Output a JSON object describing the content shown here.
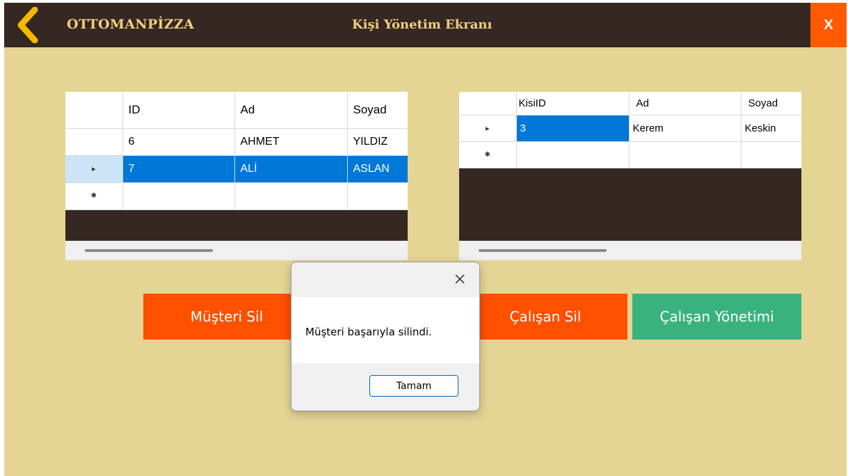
{
  "header": {
    "brand": "OTTOMANPİZZA",
    "title": "Kişi Yönetim Ekranı",
    "close_label": "X",
    "back_icon": "chevron-left-icon"
  },
  "colors": {
    "header_bg": "#352722",
    "window_bg": "#e5d595",
    "accent_orange": "#ff5000",
    "accent_green": "#3ab27f",
    "selection": "#0078d7"
  },
  "customer_grid": {
    "columns": [
      "ID",
      "Ad",
      "Soyad"
    ],
    "rows": [
      {
        "indicator": "",
        "cells": [
          "6",
          "AHMET",
          "YILDIZ"
        ]
      },
      {
        "indicator": "▸",
        "cells": [
          "7",
          "ALİ",
          "ASLAN"
        ]
      },
      {
        "indicator": "✱",
        "cells": [
          "",
          "",
          ""
        ]
      }
    ],
    "selected_row": 1
  },
  "employee_grid": {
    "columns": [
      "KisiID",
      "Ad",
      "Soyad"
    ],
    "rows": [
      {
        "indicator": "▸",
        "cells": [
          "3",
          "Kerem",
          "Keskin"
        ]
      },
      {
        "indicator": "✱",
        "cells": [
          "",
          "",
          ""
        ]
      }
    ],
    "selected_cell": [
      0,
      0
    ]
  },
  "buttons": {
    "delete_customer": "Müşteri Sil",
    "delete_employee": "Çalışan Sil",
    "employee_management": "Çalışan Yönetimi"
  },
  "dialog": {
    "message": "Müşteri başarıyla silindi.",
    "ok_label": "Tamam"
  }
}
